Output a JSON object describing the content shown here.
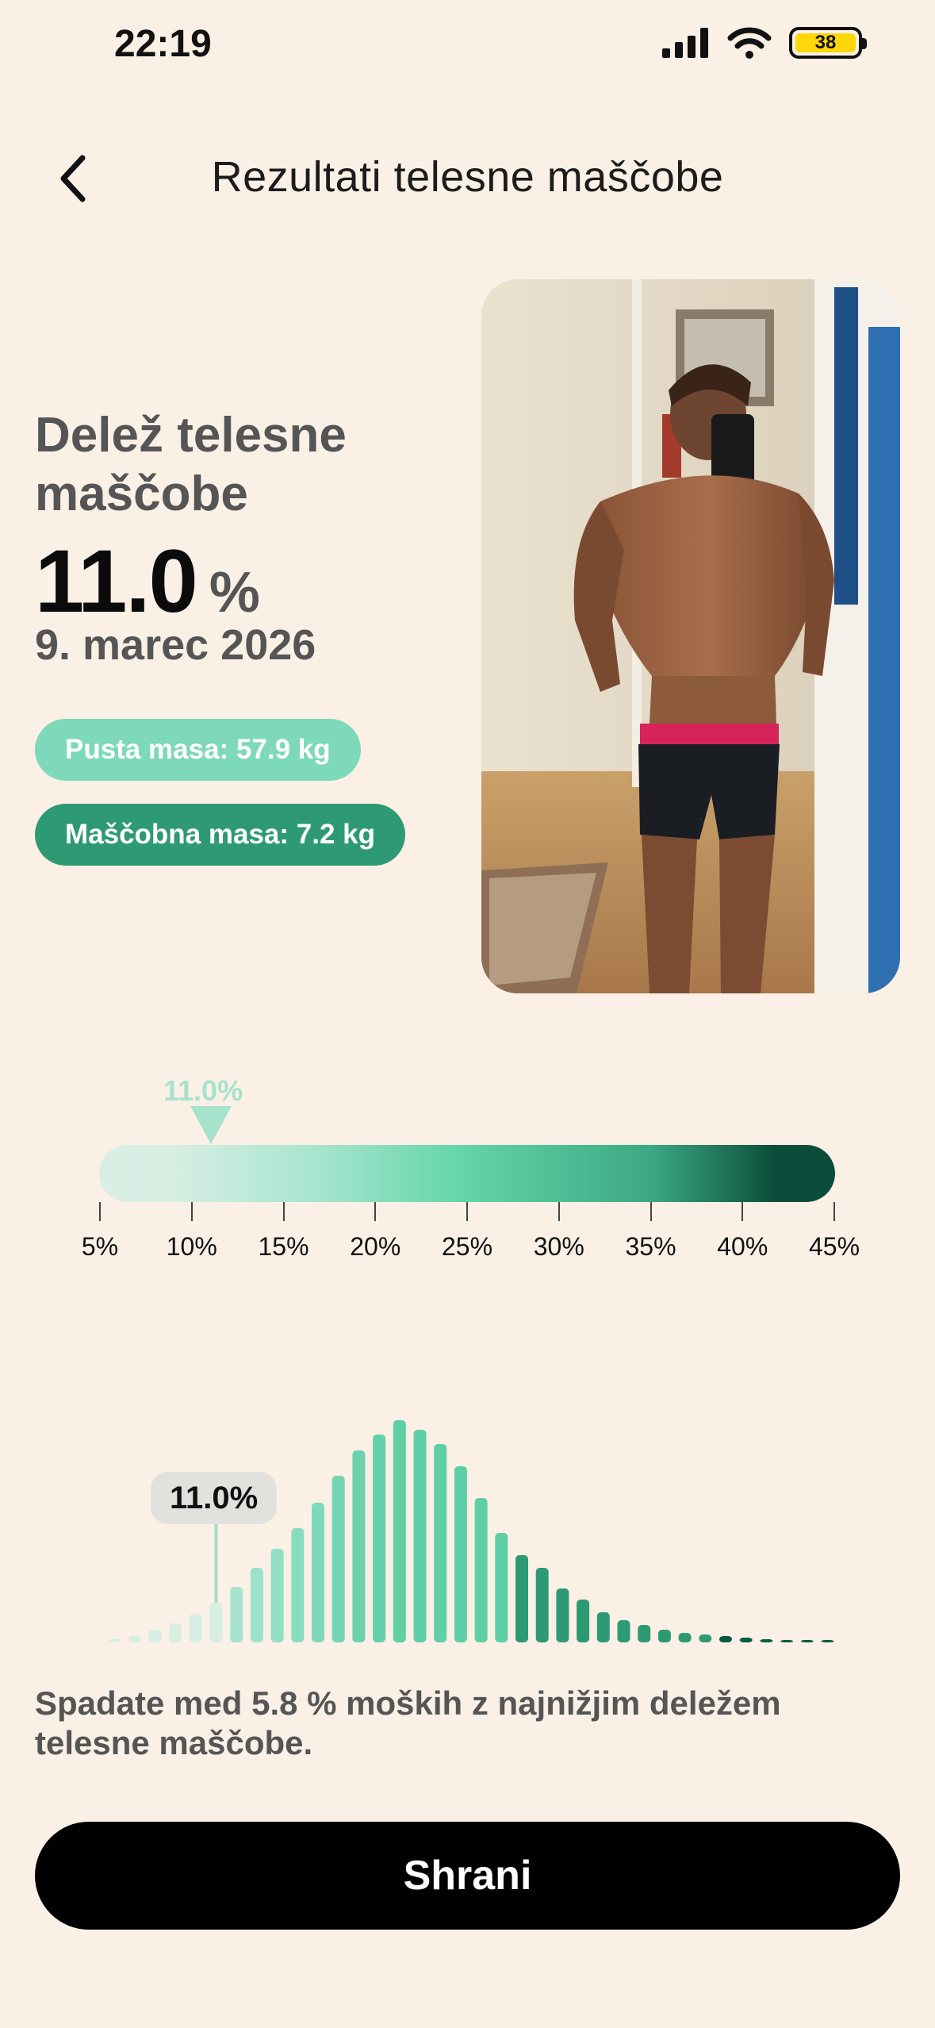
{
  "status_bar": {
    "time": "22:19",
    "battery": "38"
  },
  "header": {
    "title": "Rezultati telesne maščobe",
    "back_icon": "chevron-left-icon"
  },
  "result": {
    "label": "Delež telesne maščobe",
    "value": "11.0",
    "unit": "%",
    "date": "9. marec 2026",
    "lean_mass": "Pusta masa: 57.9 kg",
    "fat_mass": "Maščobna masa: 7.2 kg"
  },
  "colors": {
    "lean": "#7ED8BA",
    "fat": "#2E9A74",
    "background": "#FAF0E6",
    "button": "#000000"
  },
  "scale": {
    "marker_label": "11.0%",
    "marker_value": 11.0,
    "min": 5,
    "max": 45,
    "ticks": [
      "5%",
      "10%",
      "15%",
      "20%",
      "25%",
      "30%",
      "35%",
      "40%",
      "45%"
    ]
  },
  "chart_data": {
    "type": "bar",
    "title": "",
    "highlight_label": "11.0%",
    "values": [
      2,
      4,
      8,
      12,
      18,
      25,
      35,
      47,
      59,
      72,
      88,
      105,
      121,
      131,
      140,
      134,
      125,
      111,
      91,
      69,
      55,
      47,
      34,
      27,
      19,
      14,
      11,
      8,
      6,
      5,
      4,
      3,
      2,
      1.5,
      1,
      0.8
    ]
  },
  "description": "Spadate med 5.8 % moških z najnižjim deležem telesne maščobe.",
  "save_button": "Shrani"
}
